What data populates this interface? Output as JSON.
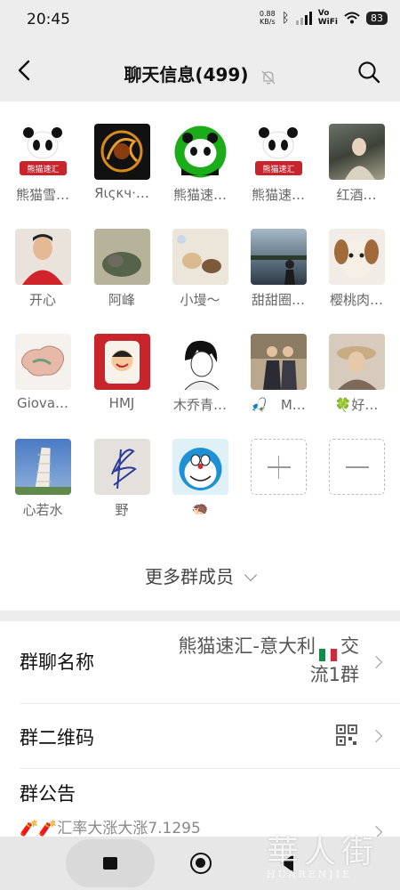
{
  "status": {
    "time": "20:45",
    "net_speed_value": "0.88",
    "net_speed_unit": "KB/s",
    "vowifi_top": "Vo",
    "vowifi_bottom": "WiFi",
    "battery": "83"
  },
  "nav": {
    "title": "聊天信息(499)"
  },
  "members": [
    {
      "name": "熊猫雪…",
      "icon": "panda-logo"
    },
    {
      "name": "Яιςκч·…",
      "icon": "dragon-avatar"
    },
    {
      "name": "熊猫速…",
      "icon": "green-panda"
    },
    {
      "name": "熊猫速…",
      "icon": "panda-logo"
    },
    {
      "name": "红酒…",
      "icon": "photo"
    },
    {
      "name": "开心",
      "icon": "photo"
    },
    {
      "name": "阿峰",
      "icon": "cat-photo"
    },
    {
      "name": "小墁～",
      "icon": "cat-photo"
    },
    {
      "name": "甜甜圈…",
      "icon": "photo"
    },
    {
      "name": "樱桃肉…",
      "icon": "dog-photo"
    },
    {
      "name": "Giova…",
      "icon": "map-china"
    },
    {
      "name": "HMJ",
      "icon": "cartoon"
    },
    {
      "name": "木乔青…",
      "icon": "anime"
    },
    {
      "name": "🎣　M…",
      "icon": "photo"
    },
    {
      "name": "🍀好…",
      "icon": "photo"
    },
    {
      "name": "心若水",
      "icon": "pisa-tower"
    },
    {
      "name": "野",
      "icon": "signature"
    },
    {
      "name": "🦔",
      "icon": "doraemon"
    }
  ],
  "more_members": "更多群成员",
  "settings": {
    "group_name_label": "群聊名称",
    "group_name_value_1": "熊猫速汇-意大利",
    "group_name_value_2": "交",
    "group_name_value_3": "流1群",
    "qr_label": "群二维码",
    "notice_label": "群公告",
    "notice_text": "🧨🧨汇率大涨大涨7.1295"
  },
  "watermark": {
    "big": "華人街",
    "small": "HUARENJIE"
  },
  "colors": {
    "panda_red": "#c8242c",
    "wechat_green": "#1aad19",
    "italy_green": "#009246",
    "italy_red": "#ce2b37"
  }
}
